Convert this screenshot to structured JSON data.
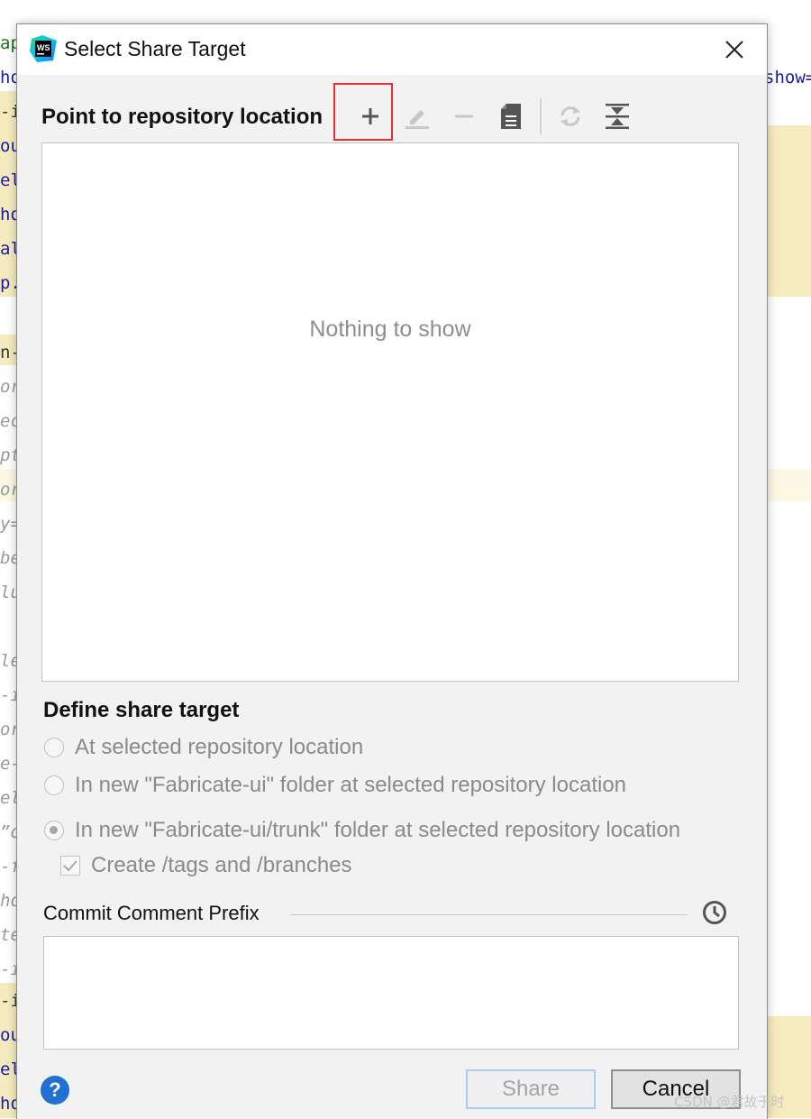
{
  "background_editor": {
    "fragments": [
      "ap",
      "ho",
      "-i",
      "ou",
      "el",
      "ho",
      "al",
      "p.",
      "n-",
      "or",
      "ec",
      "pt",
      "or",
      "y=",
      "be",
      "lu",
      "le",
      "-i",
      "or",
      "e-",
      "el",
      "”o",
      "-f",
      "ho",
      "te",
      "-i",
      "-i",
      "ou",
      "el",
      "ho"
    ],
    "right_fragment": "show="
  },
  "dialog": {
    "title": "Select Share Target",
    "app_icon_text": "WS",
    "close_icon": "close-icon",
    "repository": {
      "title": "Point to repository location",
      "toolbar": [
        {
          "name": "add-icon",
          "enabled": true
        },
        {
          "name": "edit-icon",
          "enabled": false
        },
        {
          "name": "remove-icon",
          "enabled": false
        },
        {
          "name": "browse-icon",
          "enabled": true
        },
        {
          "name": "refresh-icon",
          "enabled": false
        },
        {
          "name": "collapse-icon",
          "enabled": true
        }
      ],
      "empty_text": "Nothing to show"
    },
    "share_target": {
      "title": "Define share target",
      "options": [
        {
          "label": "At selected repository location",
          "checked": false
        },
        {
          "label": "In new \"Fabricate-ui\" folder at selected repository location",
          "checked": false
        },
        {
          "label": "In new \"Fabricate-ui/trunk\" folder at selected repository location",
          "checked": true
        }
      ],
      "create_tags_label": "Create /tags and /branches",
      "create_tags_checked": true
    },
    "commit": {
      "label": "Commit Comment Prefix",
      "value": "",
      "history_icon": "history-icon"
    },
    "help_label": "?",
    "share_label": "Share",
    "cancel_label": "Cancel"
  },
  "watermark": "CSDN @君故于时",
  "colors": {
    "highlight_box": "#e83030",
    "help_blue": "#2170d4",
    "editor_highlight": "#f5ebbf",
    "share_border": "#a9cdee"
  }
}
